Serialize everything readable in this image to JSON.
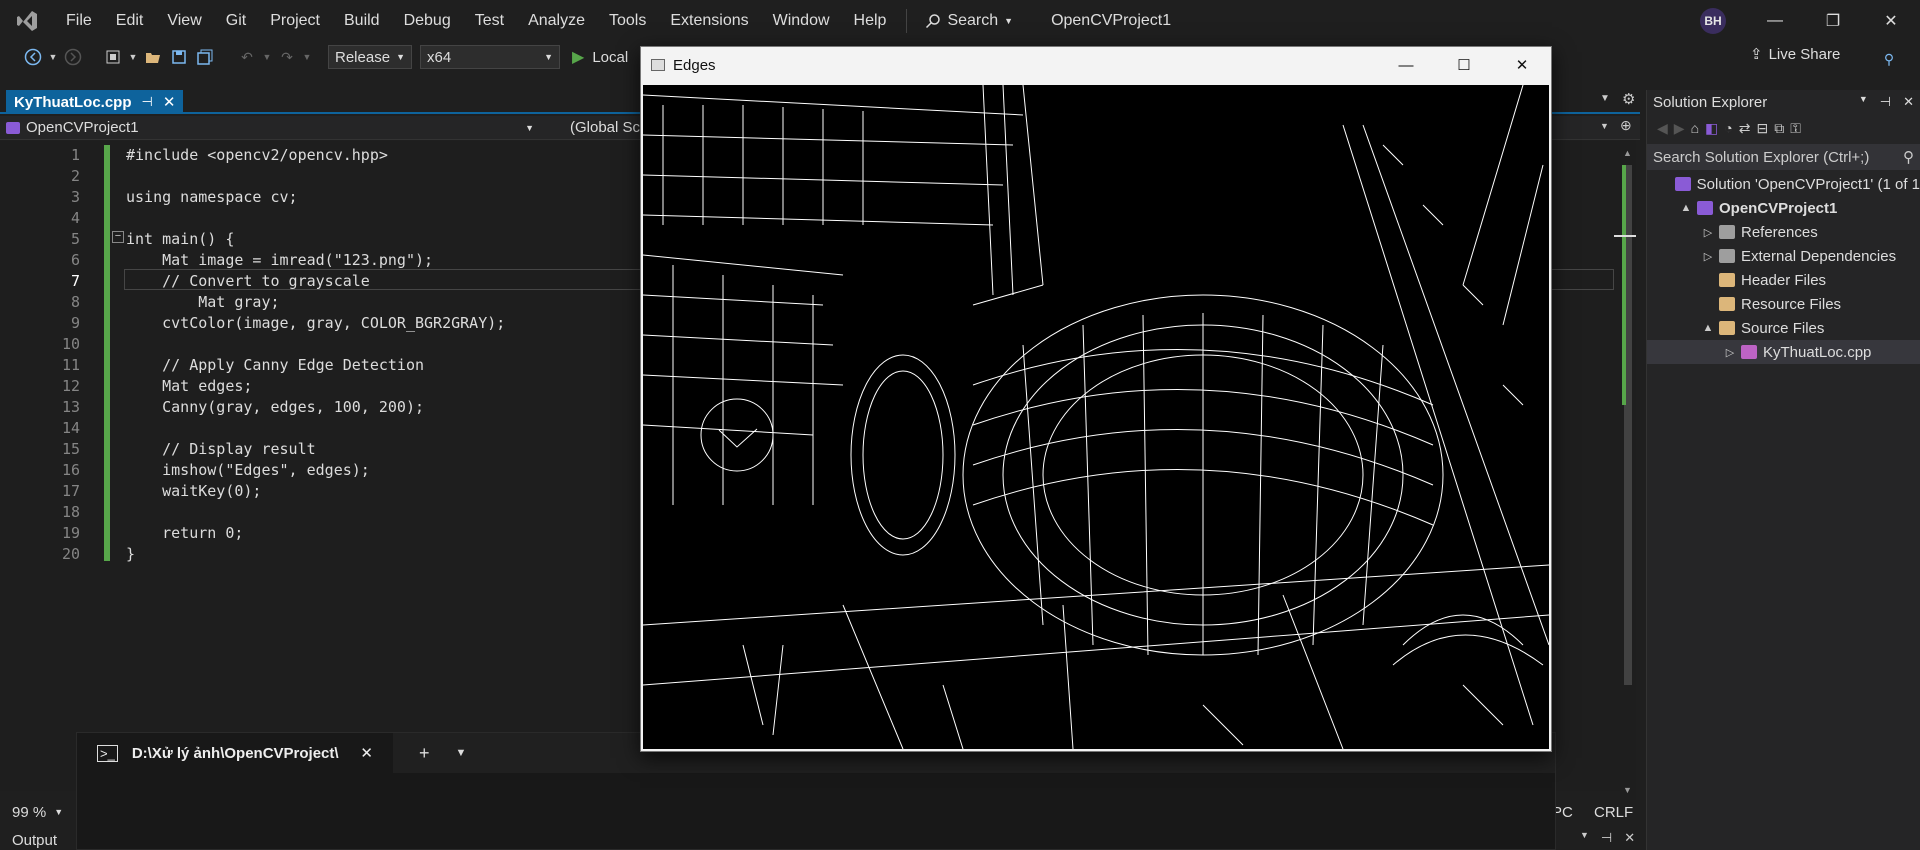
{
  "menubar": {
    "items": [
      "File",
      "Edit",
      "View",
      "Git",
      "Project",
      "Build",
      "Debug",
      "Test",
      "Analyze",
      "Tools",
      "Extensions",
      "Window",
      "Help"
    ],
    "search_label": "Search",
    "project_title": "OpenCVProject1",
    "avatar_initials": "BH"
  },
  "toolbar": {
    "config": "Release",
    "platform": "x64",
    "run_label": "Local",
    "live_share": "Live Share"
  },
  "editor": {
    "tab_label": "KyThuatLoc.cpp",
    "nav_project": "OpenCVProject1",
    "nav_scope": "(Global Sc",
    "current_line": 7,
    "lines": [
      "#include <opencv2/opencv.hpp>",
      "",
      "using namespace cv;",
      "",
      "int main() {",
      "    Mat image = imread(\"123.png\");",
      "    // Convert to grayscale",
      "        Mat gray;",
      "    cvtColor(image, gray, COLOR_BGR2GRAY);",
      "",
      "    // Apply Canny Edge Detection",
      "    Mat edges;",
      "    Canny(gray, edges, 100, 200);",
      "",
      "    // Display result",
      "    imshow(\"Edges\", edges);",
      "    waitKey(0);",
      "",
      "    return 0;",
      "}"
    ]
  },
  "status": {
    "zoom": "99 %",
    "encoding_partial": "PC",
    "line_ending": "CRLF",
    "output_tab": "Output"
  },
  "solution_explorer": {
    "title": "Solution Explorer",
    "search_placeholder": "Search Solution Explorer (Ctrl+;)",
    "items": [
      {
        "label": "Solution 'OpenCVProject1' (1 of 1",
        "level": 0,
        "arrow": "",
        "icon": "solution-icon",
        "bold": false
      },
      {
        "label": "OpenCVProject1",
        "level": 1,
        "arrow": "▲",
        "icon": "project-icon",
        "bold": true
      },
      {
        "label": "References",
        "level": 2,
        "arrow": "▷",
        "icon": "references-icon",
        "bold": false
      },
      {
        "label": "External Dependencies",
        "level": 2,
        "arrow": "▷",
        "icon": "folder-icon",
        "bold": false
      },
      {
        "label": "Header Files",
        "level": 2,
        "arrow": "",
        "icon": "filter-folder-icon",
        "bold": false
      },
      {
        "label": "Resource Files",
        "level": 2,
        "arrow": "",
        "icon": "filter-folder-icon",
        "bold": false
      },
      {
        "label": "Source Files",
        "level": 2,
        "arrow": "▲",
        "icon": "filter-folder-icon",
        "bold": false
      },
      {
        "label": "KyThuatLoc.cpp",
        "level": 3,
        "arrow": "▷",
        "icon": "cpp-file-icon",
        "bold": false
      }
    ]
  },
  "terminal": {
    "tab_label": "D:\\Xử lý ảnh\\OpenCVProject\\"
  },
  "edges_window": {
    "title": "Edges"
  }
}
